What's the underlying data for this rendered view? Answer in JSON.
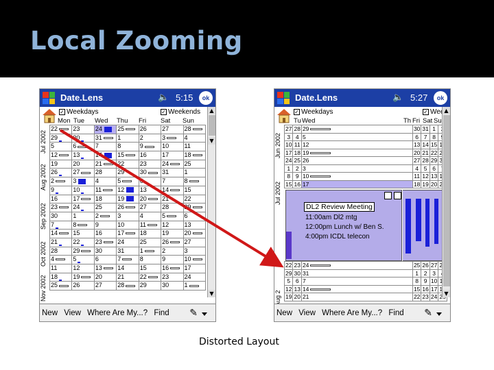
{
  "slide": {
    "title": "Local Zooming",
    "caption": "Distorted Layout"
  },
  "app": {
    "name": "Date.Lens",
    "brand_color": "#1c3fa5",
    "highlight_color": "#b8b0f0",
    "event_color": "#1a20d8"
  },
  "left": {
    "time": "5:15",
    "ok": "ok",
    "weekdays": "Weekdays",
    "weekends": "Weekends",
    "days": [
      "Mon",
      "Tue",
      "Wed",
      "Thu",
      "Fri",
      "Sat",
      "Sun"
    ],
    "months": [
      "Jul 2002",
      "Aug 2002",
      "Sep 2002",
      "Oct 2002",
      "Nov 2002"
    ],
    "weeks": [
      [
        "22",
        "23",
        "24",
        "25",
        "26",
        "27",
        "28"
      ],
      [
        "29",
        "30",
        "31",
        "1",
        "2",
        "3",
        "4"
      ],
      [
        "5",
        "6",
        "7",
        "8",
        "9",
        "10",
        "11"
      ],
      [
        "12",
        "13",
        "14",
        "15",
        "16",
        "17",
        "18"
      ],
      [
        "19",
        "20",
        "21",
        "22",
        "23",
        "24",
        "25"
      ],
      [
        "26",
        "27",
        "28",
        "29",
        "30",
        "31",
        "1"
      ],
      [
        "2",
        "3",
        "4",
        "5",
        "6",
        "7",
        "8"
      ],
      [
        "9",
        "10",
        "11",
        "12",
        "13",
        "14",
        "15"
      ],
      [
        "16",
        "17",
        "18",
        "19",
        "20",
        "21",
        "22"
      ],
      [
        "23",
        "24",
        "25",
        "26",
        "27",
        "28",
        "29"
      ],
      [
        "30",
        "1",
        "2",
        "3",
        "4",
        "5",
        "6"
      ],
      [
        "7",
        "8",
        "9",
        "10",
        "11",
        "12",
        "13"
      ],
      [
        "14",
        "15",
        "16",
        "17",
        "18",
        "19",
        "20"
      ],
      [
        "21",
        "22",
        "23",
        "24",
        "25",
        "26",
        "27"
      ],
      [
        "28",
        "29",
        "30",
        "31",
        "1",
        "2",
        "3"
      ],
      [
        "4",
        "5",
        "6",
        "7",
        "8",
        "9",
        "10"
      ],
      [
        "11",
        "12",
        "13",
        "14",
        "15",
        "16",
        "17"
      ],
      [
        "18",
        "19",
        "20",
        "21",
        "22",
        "23",
        "24"
      ],
      [
        "25",
        "26",
        "27",
        "28",
        "29",
        "30",
        "1"
      ]
    ]
  },
  "right": {
    "time": "5:27",
    "ok": "ok",
    "weekdays": "Weekdays",
    "weekends": "Wee",
    "days": [
      "Tu",
      "Wed",
      "Th",
      "Fri",
      "Sat",
      "Su"
    ],
    "months": [
      "Jun 2002",
      "Jul 2002",
      "Aug 2"
    ],
    "top_rows": [
      [
        "27",
        "28",
        "29",
        "30",
        "31",
        "1",
        "2"
      ],
      [
        "3",
        "4",
        "5",
        "6",
        "7",
        "8",
        "9"
      ],
      [
        "10",
        "11",
        "12",
        "13",
        "14",
        "15",
        "16"
      ],
      [
        "17",
        "18",
        "19",
        "20",
        "21",
        "22",
        "23"
      ],
      [
        "24",
        "25",
        "26",
        "27",
        "28",
        "29",
        "30"
      ],
      [
        "1",
        "2",
        "3",
        "4",
        "5",
        "6",
        "7"
      ],
      [
        "8",
        "9",
        "10",
        "11",
        "12",
        "13",
        "14"
      ],
      [
        "15",
        "16",
        "17",
        "18",
        "19",
        "20",
        "21"
      ]
    ],
    "bottom_rows": [
      [
        "22",
        "23",
        "24",
        "25",
        "26",
        "27",
        "28"
      ],
      [
        "29",
        "30",
        "31",
        "1",
        "2",
        "3",
        "4"
      ],
      [
        "5",
        "6",
        "7",
        "8",
        "9",
        "10",
        "11"
      ],
      [
        "12",
        "13",
        "14",
        "15",
        "16",
        "17",
        "18"
      ],
      [
        "19",
        "20",
        "21",
        "22",
        "23",
        "24",
        "25"
      ]
    ],
    "event_title": "DL2 Review Meeting",
    "events": [
      "11:00am  Dl2 mtg",
      "12:00pm  Lunch w/ Ben S.",
      "4:00pm   ICDL telecon"
    ]
  },
  "menu": [
    "New",
    "View",
    "Where Are My...?",
    "Find"
  ]
}
